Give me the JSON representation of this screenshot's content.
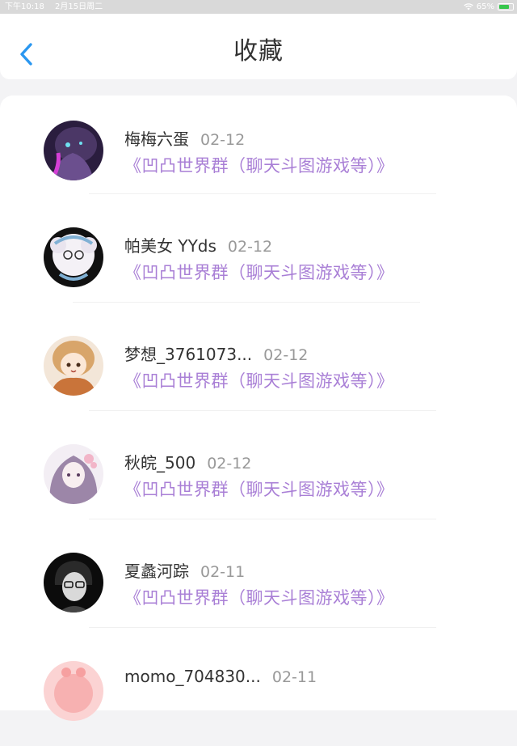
{
  "status_bar": {
    "time": "下午10:18",
    "date": "2月15日周二",
    "battery": "65%"
  },
  "nav": {
    "title": "收藏"
  },
  "colors": {
    "accent": "#2a97f0",
    "group_link": "#a97fd6",
    "name": "#333333",
    "date": "#999999"
  },
  "favorites": [
    {
      "name": "梅梅六蛋",
      "date": "02-12",
      "group": "《凹凸世界群（聊天斗图游戏等）》"
    },
    {
      "name": "帕美女 YYds",
      "date": "02-12",
      "group": "《凹凸世界群（聊天斗图游戏等）》"
    },
    {
      "name": "梦想_3761073...",
      "date": "02-12",
      "group": "《凹凸世界群（聊天斗图游戏等）》"
    },
    {
      "name": "秋皖_500",
      "date": "02-12",
      "group": "《凹凸世界群（聊天斗图游戏等）》"
    },
    {
      "name": "夏蠡河踪",
      "date": "02-11",
      "group": "《凹凸世界群（聊天斗图游戏等）》"
    },
    {
      "name": "momo_704830...",
      "date": "02-11",
      "group": ""
    }
  ]
}
